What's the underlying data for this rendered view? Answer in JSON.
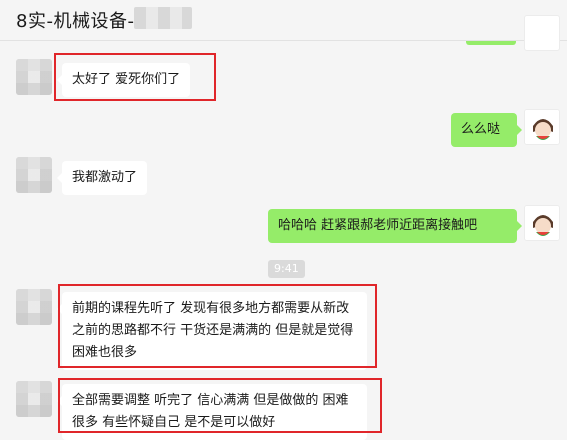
{
  "window": {
    "title": "8实-机械设备-",
    "more_icon": "more-dots-icon"
  },
  "colors": {
    "self_bubble": "#95ec69",
    "other_bubble": "#ffffff",
    "highlight": "#e0262a",
    "background": "#f5f5f5"
  },
  "messages": [
    {
      "side": "left",
      "text": "太好了  爱死你们了",
      "highlighted": true
    },
    {
      "side": "right",
      "text": "么么哒",
      "highlighted": false
    },
    {
      "side": "left",
      "text": "我都激动了",
      "highlighted": false
    },
    {
      "side": "right",
      "text": "哈哈哈    赶紧跟郝老师近距离接触吧",
      "highlighted": false
    },
    {
      "side": "left",
      "text": "前期的课程先听了  发现有很多地方都需要从新改 之前的思路都不行  干货还是满满的 但是就是觉得 困难也很多",
      "highlighted": true
    },
    {
      "side": "left",
      "text": "全部需要调整 听完了 信心满满  但是做做的 困难很多 有些怀疑自己 是不是可以做好",
      "highlighted": true
    }
  ],
  "timestamp": "9:41"
}
